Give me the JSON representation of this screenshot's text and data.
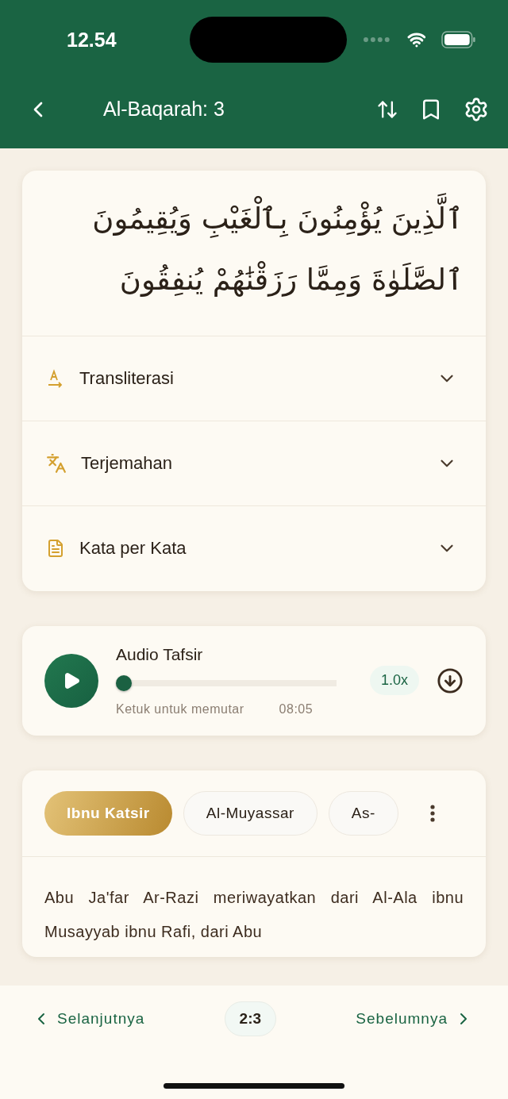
{
  "status_bar": {
    "time": "12.54"
  },
  "header": {
    "title": "Al-Baqarah: 3"
  },
  "verse": {
    "arabic_lines": [
      "ٱلَّذِينَ يُؤْمِنُونَ بِٱلْغَيْبِ وَيُقِيمُونَ",
      "ٱلصَّلَوٰةَ وَمِمَّا رَزَقْنَٰهُمْ يُنفِقُونَ"
    ]
  },
  "sections": [
    {
      "kind": "transliteration",
      "label": "Transliterasi",
      "expanded": false
    },
    {
      "kind": "translation",
      "label": "Terjemahan",
      "expanded": false
    },
    {
      "kind": "words",
      "label": "Kata per Kata",
      "expanded": false
    }
  ],
  "audio": {
    "title": "Audio Tafsir",
    "level": 0,
    "hint": "Ketuk untuk memutar",
    "duration": "08:05",
    "speed": "1.0x"
  },
  "tafsir": {
    "sources": [
      {
        "label": "Ibnu Katsir",
        "selected": true
      },
      {
        "label": "Al-Muyassar",
        "selected": false
      },
      {
        "label": "As-",
        "selected": false
      }
    ],
    "text": "Abu Ja'far Ar-Razi meriwayatkan dari Al-Ala ibnu Musayyab ibnu Rafi, dari Abu"
  },
  "footer": {
    "prev_label": "Selanjutnya",
    "verse": "2:3",
    "next_label": "Sebelumnya"
  }
}
